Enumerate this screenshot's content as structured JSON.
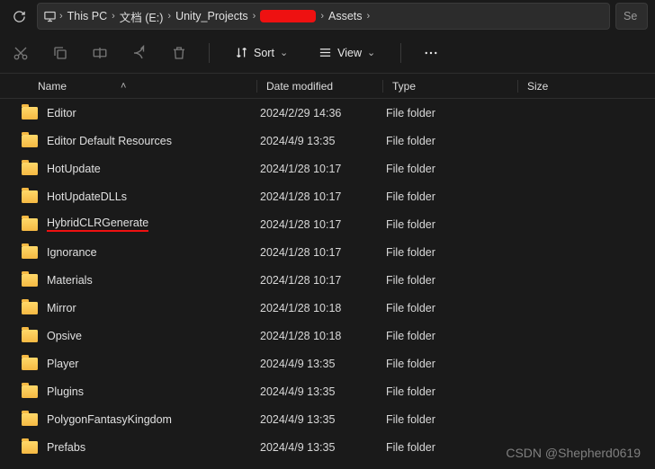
{
  "breadcrumbs": {
    "root_icon": "monitor-icon",
    "items": [
      "This PC",
      "文档 (E:)",
      "Unity_Projects",
      "[REDACTED]",
      "Assets"
    ]
  },
  "search_placeholder_trunc": "Se",
  "toolbar": {
    "sort_label": "Sort",
    "view_label": "View"
  },
  "columns": {
    "name": "Name",
    "date": "Date modified",
    "type": "Type",
    "size": "Size"
  },
  "files": [
    {
      "name": "Editor",
      "date": "2024/2/29 14:36",
      "type": "File folder",
      "highlight": false
    },
    {
      "name": "Editor Default Resources",
      "date": "2024/4/9 13:35",
      "type": "File folder",
      "highlight": false
    },
    {
      "name": "HotUpdate",
      "date": "2024/1/28 10:17",
      "type": "File folder",
      "highlight": false
    },
    {
      "name": "HotUpdateDLLs",
      "date": "2024/1/28 10:17",
      "type": "File folder",
      "highlight": false
    },
    {
      "name": "HybridCLRGenerate",
      "date": "2024/1/28 10:17",
      "type": "File folder",
      "highlight": true
    },
    {
      "name": "Ignorance",
      "date": "2024/1/28 10:17",
      "type": "File folder",
      "highlight": false
    },
    {
      "name": "Materials",
      "date": "2024/1/28 10:17",
      "type": "File folder",
      "highlight": false
    },
    {
      "name": "Mirror",
      "date": "2024/1/28 10:18",
      "type": "File folder",
      "highlight": false
    },
    {
      "name": "Opsive",
      "date": "2024/1/28 10:18",
      "type": "File folder",
      "highlight": false
    },
    {
      "name": "Player",
      "date": "2024/4/9 13:35",
      "type": "File folder",
      "highlight": false
    },
    {
      "name": "Plugins",
      "date": "2024/4/9 13:35",
      "type": "File folder",
      "highlight": false
    },
    {
      "name": "PolygonFantasyKingdom",
      "date": "2024/4/9 13:35",
      "type": "File folder",
      "highlight": false
    },
    {
      "name": "Prefabs",
      "date": "2024/4/9 13:35",
      "type": "File folder",
      "highlight": false
    }
  ],
  "watermark": "CSDN @Shepherd0619"
}
